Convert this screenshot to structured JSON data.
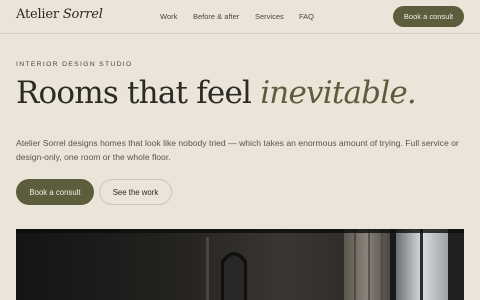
{
  "brand": {
    "name_regular": "Atelier ",
    "name_italic": "Sorrel"
  },
  "nav": {
    "items": [
      "Work",
      "Before & after",
      "Services",
      "FAQ"
    ],
    "cta_label": "Book a consult"
  },
  "hero": {
    "eyebrow": "INTERIOR DESIGN STUDIO",
    "headline_plain": "Rooms that feel ",
    "headline_italic": "inevitable.",
    "lede": "Atelier Sorrel designs homes that look like nobody tried — which takes an enormous amount of trying. Full service or design-only, one room or the whole floor.",
    "primary_cta": "Book a consult",
    "secondary_cta": "See the work"
  },
  "colors": {
    "background": "#ebe4d8",
    "accent": "#5b5d3c",
    "text": "#2c2a25"
  }
}
